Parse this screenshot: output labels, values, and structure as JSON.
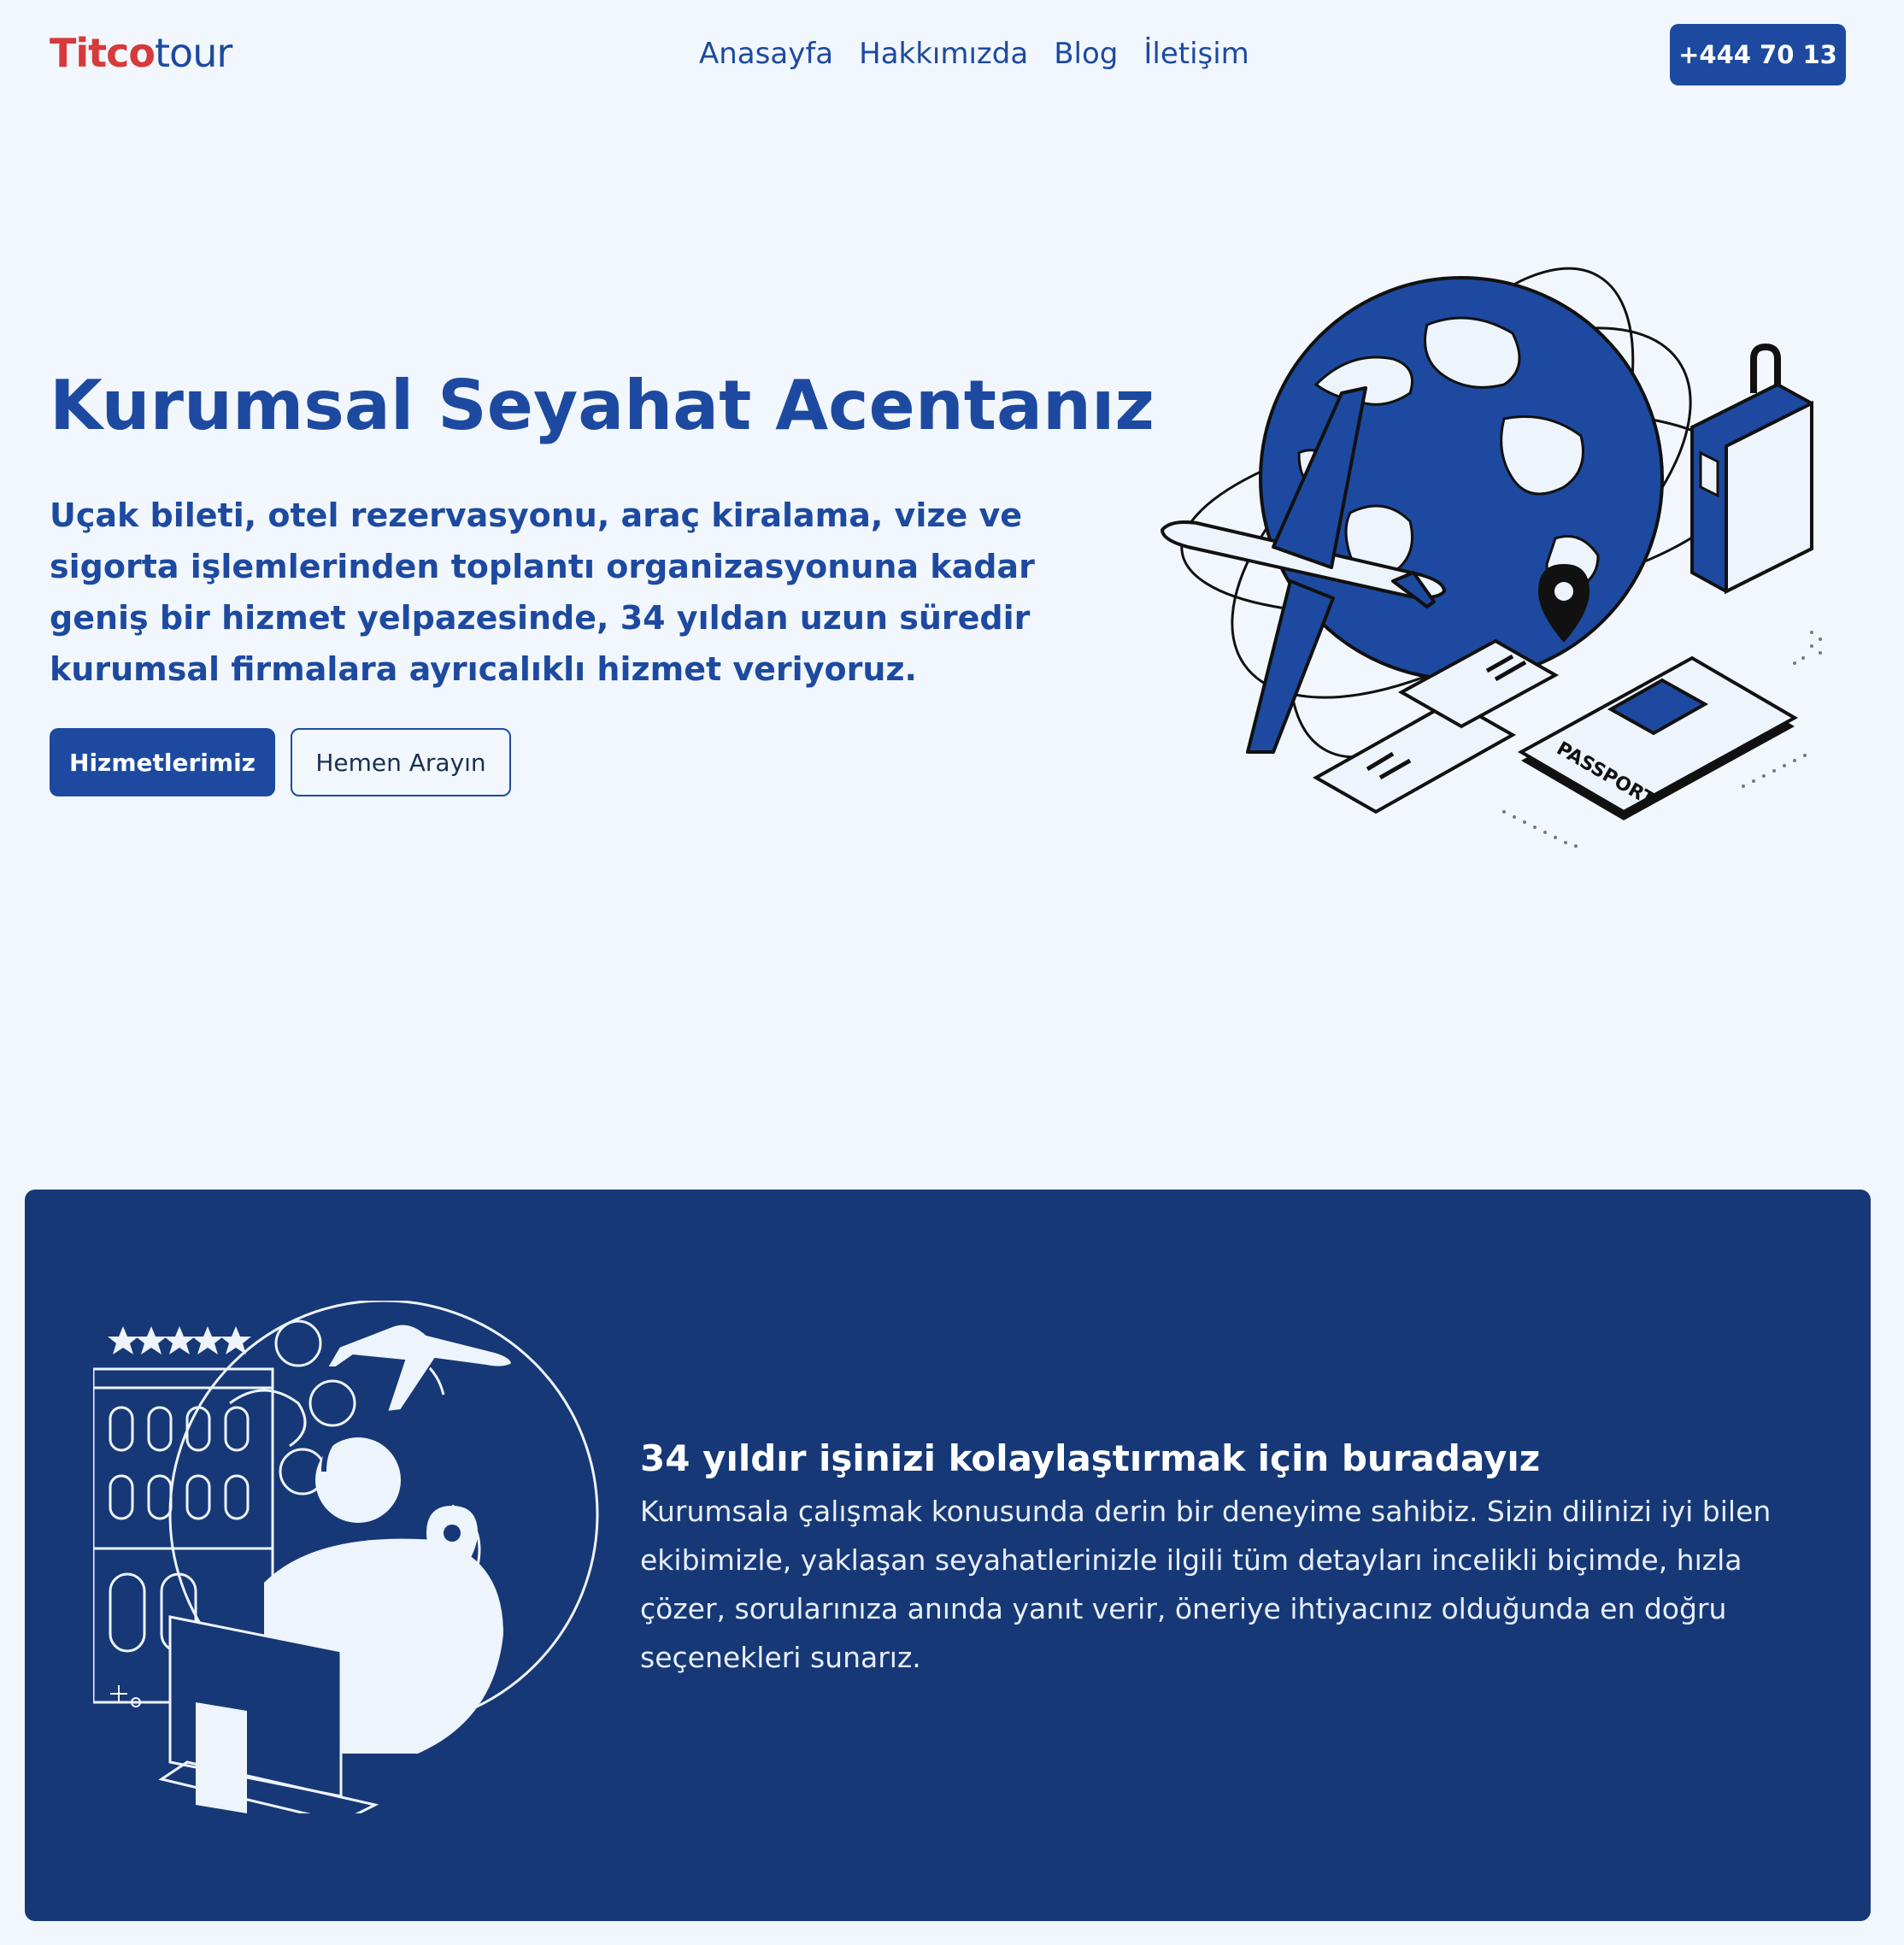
{
  "brand": {
    "logo_part1": "Titco",
    "logo_part2": "tour"
  },
  "nav": {
    "items": [
      "Anasayfa",
      "Hakkımızda",
      "Blog",
      "İletişim"
    ]
  },
  "header": {
    "phone_label": "+444 70 13"
  },
  "hero": {
    "title": "Kurumsal Seyahat Acentanız",
    "description": "Uçak bileti, otel rezervasyonu, araç kiralama, vize ve sigorta işlemlerinden toplantı organizasyonuna kadar geniş bir hizmet yelpazesinde, 34 yıldan uzun süredir kurumsal firmalara ayrıcalıklı hizmet veriyoruz.",
    "primary_button": "Hizmetlerimiz",
    "secondary_button": "Hemen Arayın",
    "illustration_passport_text": "PASSPORT"
  },
  "info": {
    "title": "34 yıldır işinizi kolaylaştırmak için buradayız",
    "text": "Kurumsala çalışmak konusunda derin bir deneyime sahibiz. Sizin dilinizi iyi bilen ekibimizle, yaklaşan seyahatlerinizle ilgili tüm detayları incelikli biçimde, hızla çözer, sorularınıza anında yanıt verir, öneriye ihtiyacınız olduğunda en doğru seçenekleri sunarız."
  },
  "colors": {
    "background": "#f2f7fd",
    "brand_blue": "#1d4aa0",
    "logo_red": "#d63a3a",
    "section_navy": "#173877"
  }
}
